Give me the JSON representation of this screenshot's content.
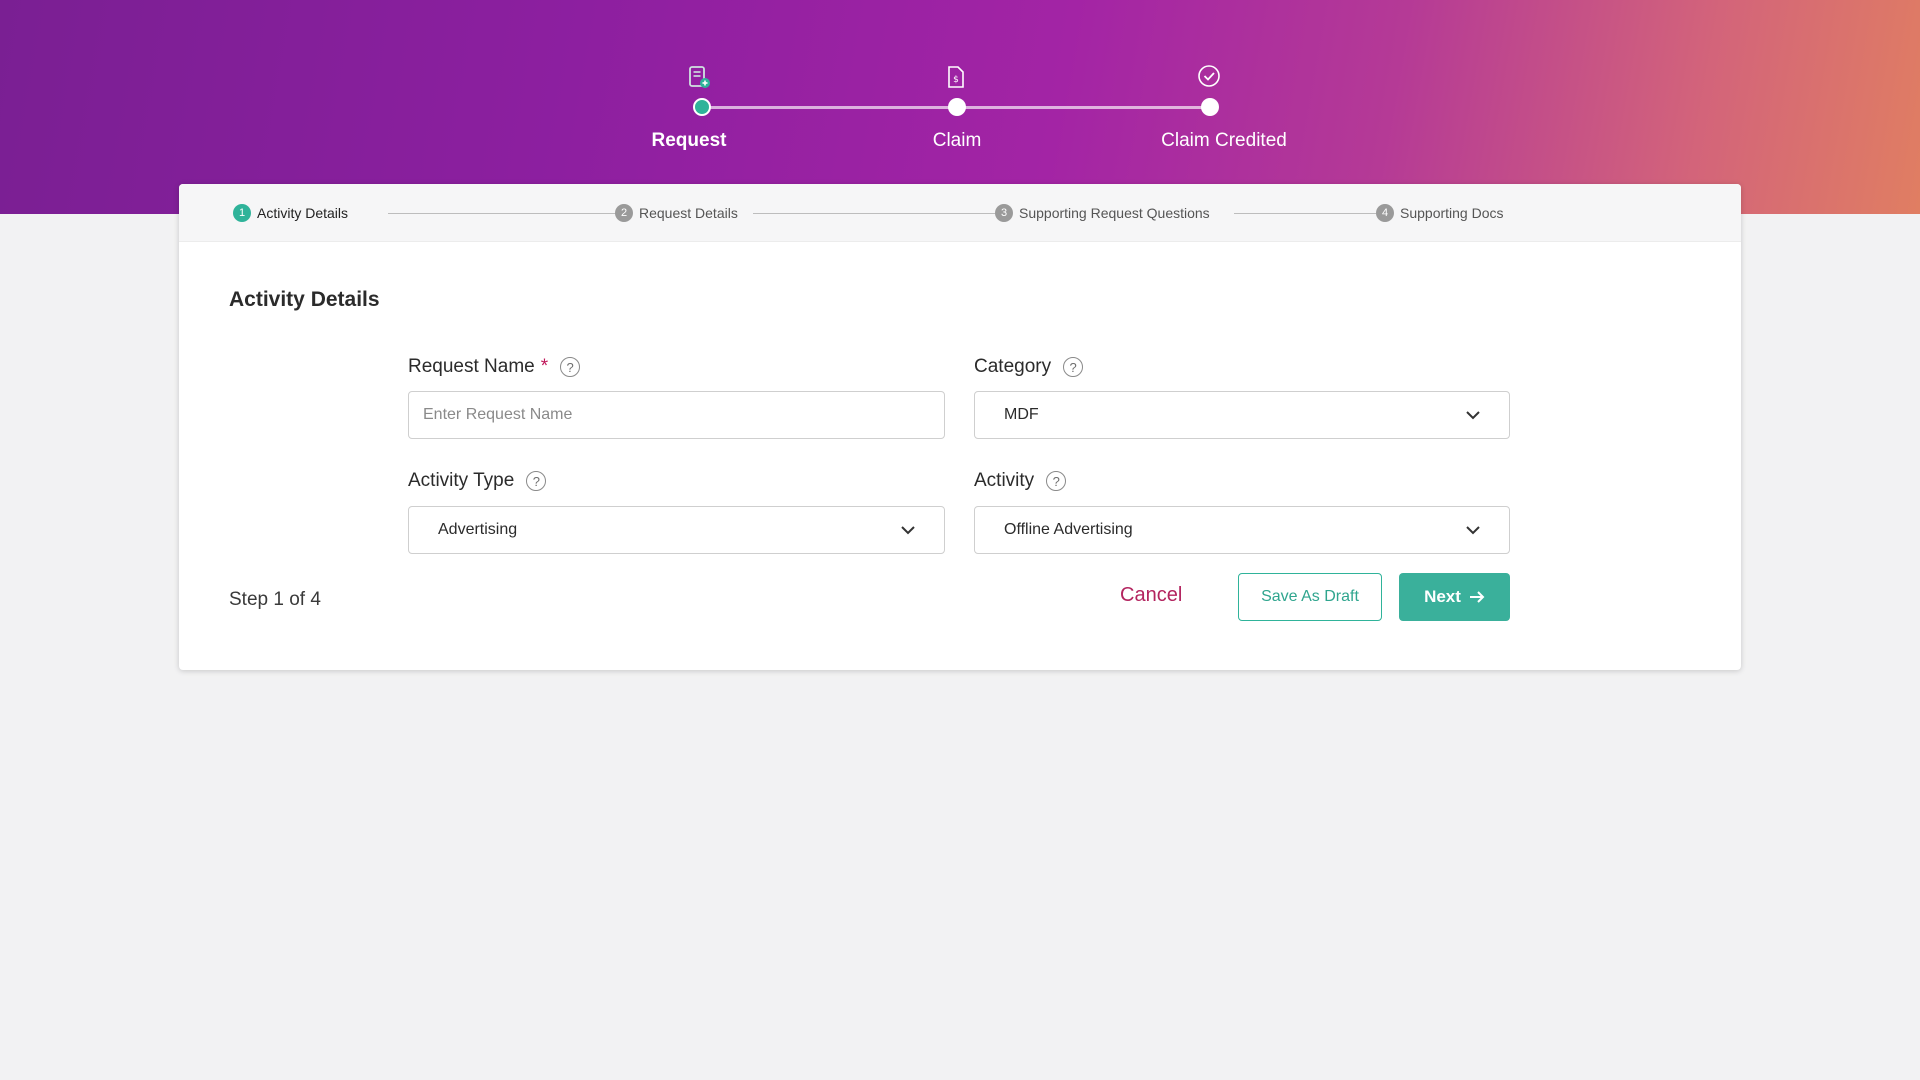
{
  "progress": {
    "steps": [
      {
        "label": "Request",
        "icon": "request-icon",
        "status": "active"
      },
      {
        "label": "Claim",
        "icon": "claim-document-icon",
        "status": "pending"
      },
      {
        "label": "Claim Credited",
        "icon": "check-circle-icon",
        "status": "pending"
      }
    ]
  },
  "substeps": [
    {
      "num": "1",
      "label": "Activity Details",
      "status": "active"
    },
    {
      "num": "2",
      "label": "Request Details",
      "status": "pending"
    },
    {
      "num": "3",
      "label": "Supporting Request Questions",
      "status": "pending"
    },
    {
      "num": "4",
      "label": "Supporting Docs",
      "status": "pending"
    }
  ],
  "form": {
    "title": "Activity Details",
    "request_name": {
      "label": "Request Name",
      "required_mark": "*",
      "placeholder": "Enter Request Name",
      "value": ""
    },
    "category": {
      "label": "Category",
      "value": "MDF"
    },
    "activity_type": {
      "label": "Activity Type",
      "value": "Advertising"
    },
    "activity": {
      "label": "Activity",
      "value": "Offline Advertising"
    },
    "help_glyph": "?"
  },
  "footer": {
    "step_text": "Step 1 of 4",
    "cancel_label": "Cancel",
    "draft_label": "Save As Draft",
    "next_label": "Next"
  },
  "colors": {
    "accent": "#2fb39a",
    "cancel": "#b3245f",
    "hero_start": "#7a1f93",
    "hero_end": "#e07e62"
  }
}
